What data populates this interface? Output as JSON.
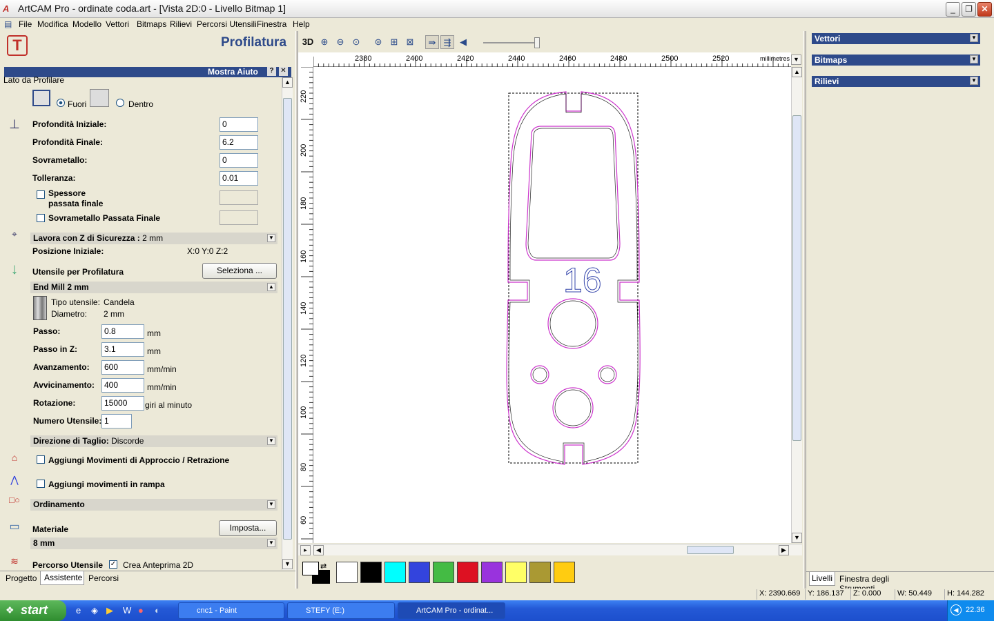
{
  "window": {
    "title": "ArtCAM Pro - ordinate coda.art - [Vista 2D:0 - Livello Bitmap 1]"
  },
  "menu": [
    "File",
    "Modifica",
    "Modello",
    "Vettori",
    "Bitmaps",
    "Rilievi",
    "Percorsi Utensili",
    "Finestra",
    "Help"
  ],
  "left": {
    "heading": "Profilatura",
    "help_label": "Mostra Aiuto",
    "side_label": "Lato da Profilare",
    "outside": "Fuori",
    "inside": "Dentro",
    "start_depth_label": "Profondità Iniziale:",
    "start_depth": "0",
    "final_depth_label": "Profondità Finale:",
    "final_depth": "6.2",
    "allowance_label": "Sovrametallo:",
    "allowance": "0",
    "tolerance_label": "Tolleranza:",
    "tolerance": "0.01",
    "final_pass_label1": "Spessore",
    "final_pass_label2": "passata finale",
    "final_allowance_label": "Sovrametallo Passata Finale",
    "safe_z_label": "Lavora con Z di Sicurezza :",
    "safe_z_value": "2 mm",
    "home_label": "Posizione Iniziale:",
    "home_value": "X:0 Y:0 Z:2",
    "tool_label": "Utensile per Profilatura",
    "select_btn": "Seleziona ...",
    "tool_name": "End Mill 2 mm",
    "tool_type_label": "Tipo utensile:",
    "tool_type": "Candela",
    "diameter_label": "Diametro:",
    "diameter": "2 mm",
    "stepover_label": "Passo:",
    "stepover": "0.8",
    "stepover_unit": "mm",
    "stepdown_label": "Passo in Z:",
    "stepdown": "3.1",
    "stepdown_unit": "mm",
    "feed_label": "Avanzamento:",
    "feed": "600",
    "feed_unit": "mm/min",
    "plunge_label": "Avvicinamento:",
    "plunge": "400",
    "plunge_unit": "mm/min",
    "spindle_label": "Rotazione:",
    "spindle": "15000",
    "spindle_unit": "giri al minuto",
    "toolnum_label": "Numero Utensile:",
    "toolnum": "1",
    "cut_dir_label": "Direzione di Taglio:",
    "cut_dir": "Discorde",
    "leadin_label": "Aggiungi Movimenti di Approccio / Retrazione",
    "ramp_label": "Aggiungi movimenti in rampa",
    "order_label": "Ordinamento",
    "material_label": "Materiale",
    "material_btn": "Imposta...",
    "material_value": "8 mm",
    "toolpath_label": "Percorso Utensile",
    "preview_label": "Crea Anteprima 2D",
    "tabs": [
      "Progetto",
      "Assistente",
      "Percorsi"
    ]
  },
  "toolbar": {
    "mode_3d": "3D"
  },
  "ruler": {
    "h_ticks": [
      "2380",
      "2400",
      "2420",
      "2440",
      "2460",
      "2480",
      "2500",
      "2520"
    ],
    "units": "millimetres",
    "v_ticks": [
      "220",
      "200",
      "180",
      "160",
      "140",
      "120",
      "100",
      "80",
      "60"
    ]
  },
  "drawing": {
    "label": "16"
  },
  "palette": [
    "#ffffff",
    "#000000",
    "#00ffff",
    "#3344dd",
    "#44bb44",
    "#dd1122",
    "#9933dd",
    "#ffff66",
    "#aa9933",
    "#ffcc11"
  ],
  "right": {
    "panels": [
      "Vettori",
      "Bitmaps",
      "Rilievi"
    ],
    "tabs": [
      "Livelli",
      "Finestra degli Strumenti"
    ]
  },
  "status": {
    "x": "X: 2390.669",
    "y": "Y: 186.137",
    "z": "Z: 0.000",
    "w": "W: 50.449",
    "h": "H: 144.282"
  },
  "taskbar": {
    "start": "start",
    "tasks": [
      "cnc1 - Paint",
      "STEFY (E:)",
      "ArtCAM Pro - ordinat..."
    ],
    "clock": "22.36"
  }
}
